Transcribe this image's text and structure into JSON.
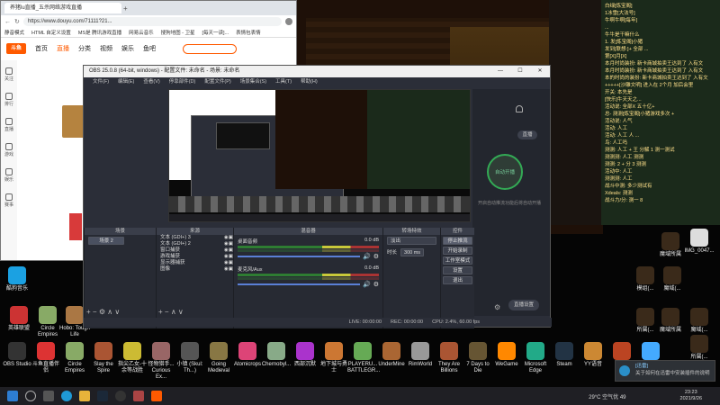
{
  "browser": {
    "tab_title": "养猪lu直播_五杀网络游戏直播",
    "url": "https://www.douyu.com/71111?21...",
    "bookmarks": [
      "静音模式",
      "HTML 自定义设置",
      "MS是 腾讯游戏直播",
      "网易云音乐",
      "搜狗地图 - 卫星",
      "[每天一读]...",
      "表情包表情"
    ],
    "site_nav": [
      "首页",
      "直播",
      "分类",
      "视频",
      "娱乐",
      "鱼吧"
    ],
    "site_logo": "斗鱼",
    "sidebar": [
      "关注",
      "排行",
      "直播",
      "游戏",
      "娱乐",
      "赛事"
    ]
  },
  "chat": {
    "lines": [
      "白绿[炼宝阁]",
      "1冰雪[大法号]",
      "牛啊牛啊[每年]",
      "...",
      "牛牛是干嘛什么",
      "1. 发[炼宝阁]小猪",
      "发到[联想:]+ 全部 ...",
      "第[X]月[X]",
      "本月时尚装扮: 新卡商城拍卖王达到了 入有文",
      "本月时尚装扮: 新卡商城拍卖王达到了 入有文",
      "本的时尚的装扮: 新卡商城拍卖王达到了 入有文",
      "+++++[沙雕文明] 进入在 2个月 加后会里",
      "开关: 本先是",
      "[快乐]牛天天之...",
      "活动说: 全部X 五十亿+",
      "总- 测测[炼宝阁]小猪游戏多次 +",
      "活动说: 人气",
      "活动: 人工",
      "活动: 人工 人 ...",
      "鸟: 人工吗",
      "测测: 人工 + 王 分解 1 测一测试",
      "测测测: 人工 测测",
      "测测: 2 + 分 3 测测",
      "活动中: 人工",
      "测测测: 人工",
      "战斗中测: 多少测试有",
      "Xdeals: 测测",
      "战斗力/分: 测一 8"
    ]
  },
  "obs": {
    "title": "OBS 25.0.8 (64-bit, windows) - 配置文件: 未命名 - 场景: 未命名",
    "menu": [
      "文件(F)",
      "编辑(E)",
      "查看(V)",
      "停靠部件(D)",
      "配置文件(P)",
      "场景集合(S)",
      "工具(T)",
      "帮助(H)"
    ],
    "docks": {
      "scenes": {
        "title": "场景",
        "items": [
          "场景 2"
        ]
      },
      "sources": {
        "title": "来源",
        "items": [
          "文本 (GDI+) 3",
          "文本 (GDI+) 2",
          "窗口捕获",
          "游戏捕获",
          "显示器捕获",
          "图像"
        ]
      },
      "mixer": {
        "title": "混音器",
        "tracks": [
          {
            "name": "桌面音频",
            "level": "0.0 dB"
          },
          {
            "name": "麦克风/Aux",
            "level": "0.0 dB"
          }
        ]
      },
      "transitions": {
        "title": "转场特效",
        "type": "淡出",
        "duration_label": "时长",
        "duration": "300 ms"
      },
      "controls": {
        "title": "控件",
        "buttons": [
          "停止推流",
          "开始录制",
          "工作室模式",
          "设置",
          "退出"
        ]
      }
    },
    "status": {
      "live": "LIVE: 00:00:00",
      "rec": "REC: 00:00:00",
      "cpu": "CPU: 2.4%, 60.00 fps"
    },
    "right_panel": {
      "push_label": "自动开播",
      "message": "开启自动推流功能后将自动开播",
      "button": "直播",
      "settings": "直播设置"
    }
  },
  "desktop_left": [
    "英雄联盟",
    "Circle Empires",
    "Hobo: Tough Life",
    "OBS Studio",
    "斗鱼直播伴侣",
    "Circle Empires",
    "Slay the Spire",
    "指尖乙女-十余等战胜",
    "怪物猎手... Curious Ex...",
    "小镇 (Skul: Th...)",
    "Going Medieval",
    "Atomicrops",
    "Chernobyl...",
    "西部沉默",
    "地下城与勇士",
    "PLAYERU... BATTLEGR...",
    "UnderMine",
    "RimWorld",
    "They Are Billions",
    "7 Days to Die",
    "WeGame",
    "Microsoft Edge",
    "Steam",
    "YY语音",
    "...",
    "..."
  ],
  "desktop_right": [
    "魔域所属",
    "IMG_0047...",
    "模组(...",
    "魔域(...",
    "魔域所属",
    "魔域(...",
    "所属(...",
    "所属(..."
  ],
  "top_left_icon": {
    "label": "酷狗音乐"
  },
  "notification": {
    "title": "[迅雷]",
    "text": "关于如何在迅雷中安装插件的说明"
  },
  "taskbar": {
    "weather": "29°C 空气优 49",
    "time": "23:23",
    "date": "2021/9/26"
  },
  "colors": {
    "obs_bg": "#2b2e38",
    "brand": "#ff5a00",
    "chat_text": "#ffe08a",
    "meter_green": "#2e7d32"
  }
}
